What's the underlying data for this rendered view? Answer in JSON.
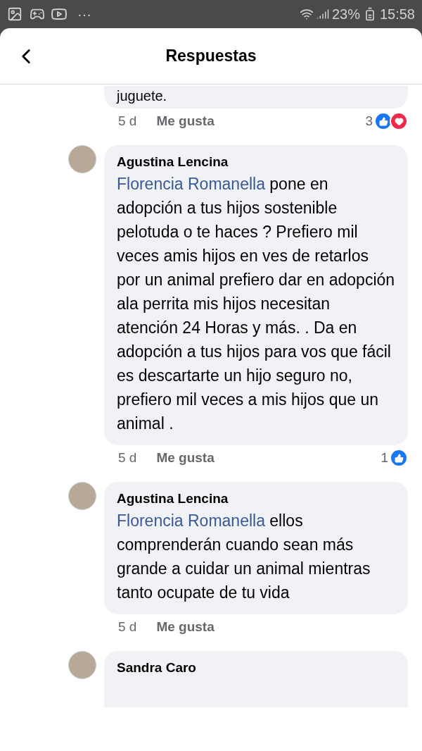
{
  "status_bar": {
    "more": "···",
    "battery": "23%",
    "time": "15:58"
  },
  "header": {
    "title": "Respuestas"
  },
  "comments": [
    {
      "kind": "partial",
      "text": "juguete.",
      "time": "5 d",
      "like_label": "Me gusta",
      "reaction_count": "3",
      "reactions": [
        {
          "kind": "like"
        },
        {
          "kind": "love"
        }
      ]
    },
    {
      "kind": "full",
      "author": "Agustina Lencina",
      "mention": "Florencia Romanella",
      "text": "pone en adopción a tus hijos sostenible pelotuda o te haces ? Prefiero mil veces amis hijos en ves de retarlos por un animal prefiero dar en adopción ala perrita mis hijos necesitan atención 24 Horas y más.  . Da en adopción a tus hijos para vos que fácil es descartarte un hijo seguro no, prefiero mil veces a mis hijos que un animal .",
      "time": "5 d",
      "like_label": "Me gusta",
      "reaction_count": "1",
      "reactions": [
        {
          "kind": "like"
        }
      ]
    },
    {
      "kind": "full",
      "author": "Agustina Lencina",
      "mention": "Florencia Romanella",
      "text": "ellos comprenderán cuando sean más grande a cuidar un animal mientras tanto ocupate de tu vida",
      "time": "5 d",
      "like_label": "Me gusta"
    },
    {
      "kind": "cut",
      "author": "Sandra Caro"
    }
  ]
}
